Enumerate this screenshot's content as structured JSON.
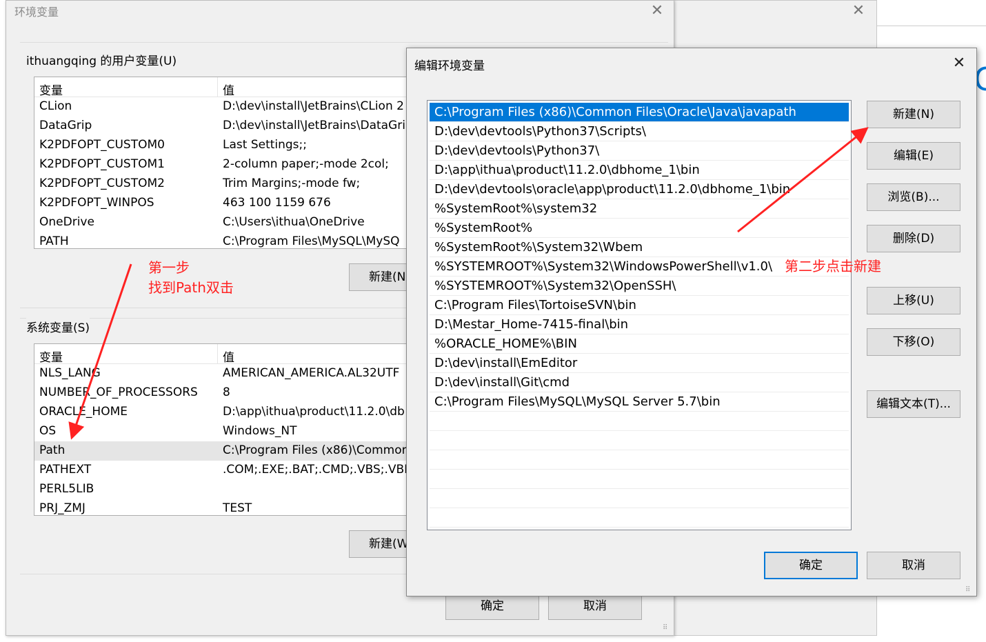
{
  "background_window": {
    "close_glyph": "✕"
  },
  "env_window": {
    "title": "环境变量",
    "close_glyph": "✕",
    "user_group_label": "ithuangqing 的用户变量(U)",
    "user_columns": [
      "变量",
      "值"
    ],
    "user_rows": [
      {
        "name": "CLion",
        "value": "D:\\dev\\install\\JetBrains\\CLion 2"
      },
      {
        "name": "DataGrip",
        "value": "D:\\dev\\install\\JetBrains\\DataGri"
      },
      {
        "name": "K2PDFOPT_CUSTOM0",
        "value": "Last Settings;;"
      },
      {
        "name": "K2PDFOPT_CUSTOM1",
        "value": "2-column paper;-mode 2col;"
      },
      {
        "name": "K2PDFOPT_CUSTOM2",
        "value": "Trim Margins;-mode fw;"
      },
      {
        "name": "K2PDFOPT_WINPOS",
        "value": "463 100 1159 676"
      },
      {
        "name": "OneDrive",
        "value": "C:\\Users\\ithua\\OneDrive"
      },
      {
        "name": "PATH",
        "value": "C:\\Program Files\\MySQL\\MySQ"
      }
    ],
    "user_new_button": "新建(N",
    "system_group_label": "系统变量(S)",
    "system_columns": [
      "变量",
      "值"
    ],
    "system_rows": [
      {
        "name": "NLS_LANG",
        "value": "AMERICAN_AMERICA.AL32UTF"
      },
      {
        "name": "NUMBER_OF_PROCESSORS",
        "value": "8"
      },
      {
        "name": "ORACLE_HOME",
        "value": "D:\\app\\ithua\\product\\11.2.0\\db"
      },
      {
        "name": "OS",
        "value": "Windows_NT"
      },
      {
        "name": "Path",
        "value": "C:\\Program Files (x86)\\Common"
      },
      {
        "name": "PATHEXT",
        "value": ".COM;.EXE;.BAT;.CMD;.VBS;.VBE;"
      },
      {
        "name": "PERL5LIB",
        "value": ""
      },
      {
        "name": "PRJ_ZMJ",
        "value": "TEST"
      }
    ],
    "system_new_button": "新建(W",
    "ok_button": "确定",
    "cancel_button": "取消"
  },
  "edit_dialog": {
    "title": "编辑环境变量",
    "close_glyph": "✕",
    "paths": [
      "C:\\Program Files (x86)\\Common Files\\Oracle\\Java\\javapath",
      "D:\\dev\\devtools\\Python37\\Scripts\\",
      "D:\\dev\\devtools\\Python37\\",
      "D:\\app\\ithua\\product\\11.2.0\\dbhome_1\\bin",
      "D:\\dev\\devtools\\oracle\\app\\product\\11.2.0\\dbhome_1\\bin",
      "%SystemRoot%\\system32",
      "%SystemRoot%",
      "%SystemRoot%\\System32\\Wbem",
      "%SYSTEMROOT%\\System32\\WindowsPowerShell\\v1.0\\",
      "%SYSTEMROOT%\\System32\\OpenSSH\\",
      "C:\\Program Files\\TortoiseSVN\\bin",
      "D:\\Mestar_Home-7415-final\\bin",
      "%ORACLE_HOME%\\BIN",
      "D:\\dev\\install\\EmEditor",
      "D:\\dev\\install\\Git\\cmd",
      "C:\\Program Files\\MySQL\\MySQL Server 5.7\\bin",
      "",
      "",
      "",
      "",
      "",
      ""
    ],
    "buttons": {
      "new": "新建(N)",
      "edit": "编辑(E)",
      "browse": "浏览(B)...",
      "delete": "删除(D)",
      "move_up": "上移(U)",
      "move_down": "下移(O)",
      "edit_text": "编辑文本(T)...",
      "ok": "确定",
      "cancel": "取消"
    }
  },
  "annotations": {
    "step1_line1": "第一步",
    "step1_line2": "找到Path双击",
    "step2": "第二步点击新建",
    "color": "#ff2222"
  }
}
